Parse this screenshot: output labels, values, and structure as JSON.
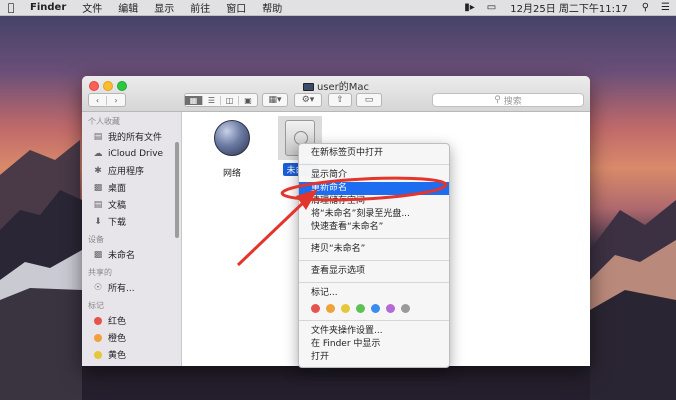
{
  "menubar": {
    "apple_icon": "apple-logo-icon",
    "items": [
      "Finder",
      "文件",
      "编辑",
      "显示",
      "前往",
      "窗口",
      "帮助"
    ],
    "clock": "12月25日 周二下午11:17"
  },
  "window": {
    "title": "user的Mac",
    "search_placeholder": "搜索"
  },
  "sidebar": {
    "favorites_header": "个人收藏",
    "favorites": [
      {
        "label": "我的所有文件",
        "icon": "all-files-icon"
      },
      {
        "label": "iCloud Drive",
        "icon": "cloud-icon"
      },
      {
        "label": "应用程序",
        "icon": "applications-icon"
      },
      {
        "label": "桌面",
        "icon": "desktop-icon"
      },
      {
        "label": "文稿",
        "icon": "documents-icon"
      },
      {
        "label": "下载",
        "icon": "download-icon"
      }
    ],
    "devices_header": "设备",
    "devices": [
      {
        "label": "未命名",
        "icon": "disk-icon"
      }
    ],
    "shared_header": "共享的",
    "shared": [
      {
        "label": "所有...",
        "icon": "network-globe-icon"
      }
    ],
    "tags_header": "标记",
    "tags": [
      {
        "label": "红色",
        "color": "#e7534c"
      },
      {
        "label": "橙色",
        "color": "#f0a13a"
      },
      {
        "label": "黄色",
        "color": "#e5c737"
      }
    ]
  },
  "content": {
    "items": [
      {
        "label": "网络",
        "icon": "network-globe-icon"
      },
      {
        "label": "未命名",
        "icon": "hard-drive-icon"
      }
    ]
  },
  "context_menu": {
    "items": [
      "在新标签页中打开",
      "显示简介",
      "重新命名",
      "清理储存空间",
      "将“未命名”刻录至光盘...",
      "快速查看“未命名”",
      "拷贝“未命名”",
      "查看显示选项",
      "标记...",
      "文件夹操作设置...",
      "在 Finder 中显示",
      "打开"
    ],
    "highlighted": "重新命名",
    "tag_colors": [
      "#e7534c",
      "#f0a13a",
      "#e5c737",
      "#5cc353",
      "#3a8df0",
      "#b66ad6",
      "#9a9a9a"
    ]
  },
  "annotation": {
    "color": "#e3352b"
  }
}
